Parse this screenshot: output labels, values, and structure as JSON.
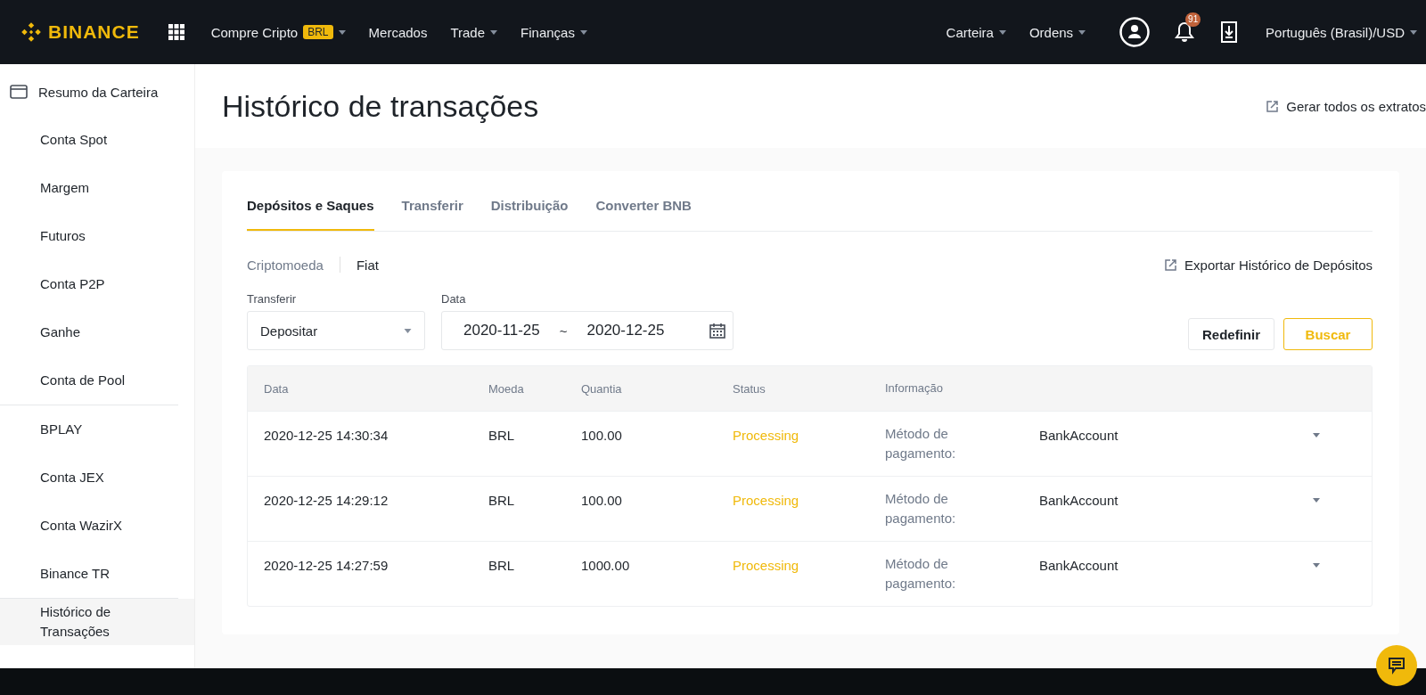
{
  "header": {
    "logo": "BINANCE",
    "nav": [
      {
        "label": "Compre Cripto",
        "badge": "BRL",
        "caret": true
      },
      {
        "label": "Mercados",
        "caret": false
      },
      {
        "label": "Trade",
        "caret": true
      },
      {
        "label": "Finanças",
        "caret": true
      }
    ],
    "right_nav": [
      {
        "label": "Carteira",
        "caret": true
      },
      {
        "label": "Ordens",
        "caret": true
      }
    ],
    "notification_count": "91",
    "language": "Português (Brasil)/USD"
  },
  "sidebar": {
    "sections": [
      {
        "items": [
          {
            "label": "Resumo da Carteira",
            "icon": true,
            "selected": false
          },
          {
            "label": "Conta Spot",
            "selected": false
          },
          {
            "label": "Margem",
            "selected": false
          },
          {
            "label": "Futuros",
            "selected": false
          },
          {
            "label": "Conta P2P",
            "selected": false
          },
          {
            "label": "Ganhe",
            "selected": false
          },
          {
            "label": "Conta de Pool",
            "selected": false
          }
        ]
      },
      {
        "items": [
          {
            "label": "BPLAY",
            "selected": false
          },
          {
            "label": "Conta JEX",
            "selected": false
          },
          {
            "label": "Conta WazirX",
            "selected": false
          },
          {
            "label": "Binance TR",
            "selected": false
          }
        ]
      },
      {
        "items": [
          {
            "label": "Histórico de Transações",
            "selected": true
          }
        ]
      }
    ]
  },
  "page": {
    "title": "Histórico de transações",
    "generate_link": "Gerar todos os extratos"
  },
  "tabs": [
    {
      "label": "Depósitos e Saques",
      "selected": true
    },
    {
      "label": "Transferir",
      "selected": false
    },
    {
      "label": "Distribuição",
      "selected": false
    },
    {
      "label": "Converter BNB",
      "selected": false
    }
  ],
  "subtabs": [
    {
      "label": "Criptomoeda",
      "selected": false
    },
    {
      "label": "Fiat",
      "selected": true
    }
  ],
  "export_link": "Exportar Histórico de Depósitos",
  "filters": {
    "type": {
      "label": "Transferir",
      "value": "Depositar"
    },
    "date": {
      "label": "Data",
      "from": "2020-11-25",
      "separator": "~",
      "to": "2020-12-25"
    }
  },
  "buttons": {
    "reset": "Redefinir",
    "search": "Buscar"
  },
  "table": {
    "columns": [
      "Data",
      "Moeda",
      "Quantia",
      "Status",
      "Informação"
    ],
    "rows": [
      {
        "date": "2020-12-25 14:30:34",
        "currency": "BRL",
        "amount": "100.00",
        "status": "Processing",
        "info_label": "Método de pagamento:",
        "info_value": "BankAccount"
      },
      {
        "date": "2020-12-25 14:29:12",
        "currency": "BRL",
        "amount": "100.00",
        "status": "Processing",
        "info_label": "Método de pagamento:",
        "info_value": "BankAccount"
      },
      {
        "date": "2020-12-25 14:27:59",
        "currency": "BRL",
        "amount": "1000.00",
        "status": "Processing",
        "info_label": "Método de pagamento:",
        "info_value": "BankAccount"
      }
    ]
  }
}
